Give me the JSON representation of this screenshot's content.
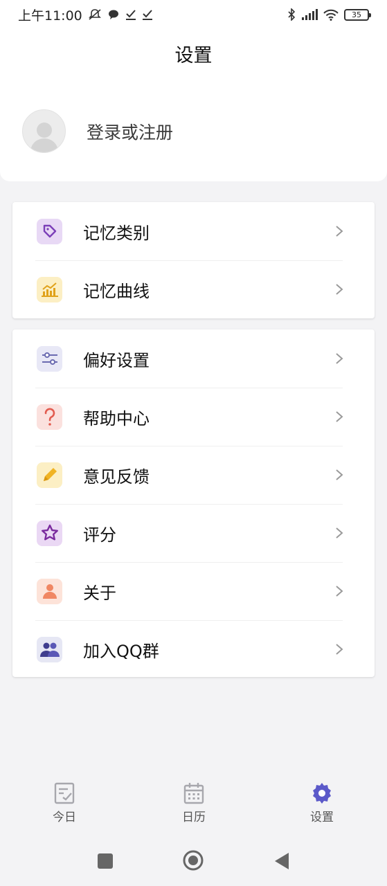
{
  "status_bar": {
    "time": "上午11:00",
    "battery": "35"
  },
  "header": {
    "title": "设置"
  },
  "profile": {
    "login_text": "登录或注册"
  },
  "group1": [
    {
      "label": "记忆类别",
      "icon": "tag-icon",
      "bg": "#e8d9f5",
      "color": "#7b3fb8"
    },
    {
      "label": "记忆曲线",
      "icon": "chart-icon",
      "bg": "#fcefc4",
      "color": "#e0a21b"
    }
  ],
  "group2": [
    {
      "label": "偏好设置",
      "icon": "sliders-icon",
      "bg": "#e8e8f6",
      "color": "#6a6ab0"
    },
    {
      "label": "帮助中心",
      "icon": "question-icon",
      "bg": "#fbe1de",
      "color": "#e25b4f"
    },
    {
      "label": "意见反馈",
      "icon": "pencil-icon",
      "bg": "#fcefc4",
      "color": "#f0b323"
    },
    {
      "label": "评分",
      "icon": "star-icon",
      "bg": "#ead8f4",
      "color": "#7a2a9e"
    },
    {
      "label": "关于",
      "icon": "person-icon",
      "bg": "#fde3d9",
      "color": "#f08763"
    },
    {
      "label": "加入QQ群",
      "icon": "group-icon",
      "bg": "#e6e7f4",
      "color": "#3f3d8e"
    }
  ],
  "tabbar": {
    "today": "今日",
    "calendar": "日历",
    "settings": "设置",
    "active_color": "#5b59c9",
    "inactive_color": "#a7a7ad"
  }
}
